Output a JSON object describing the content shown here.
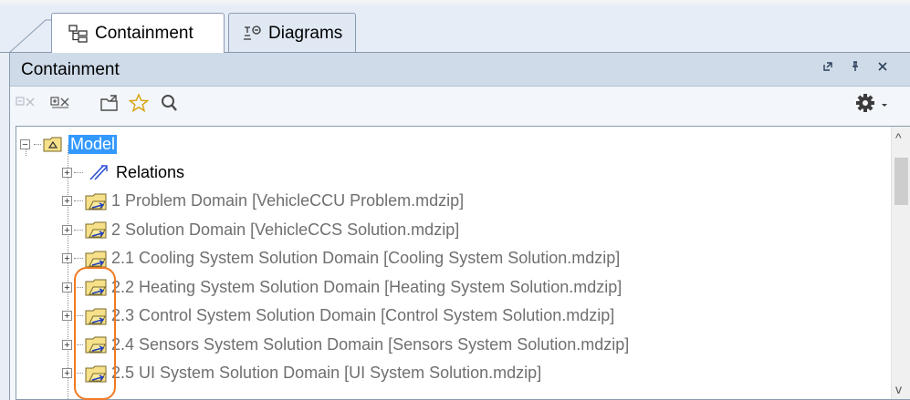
{
  "tabs": [
    {
      "label": "Containment",
      "icon": "containment-tree-icon"
    },
    {
      "label": "Diagrams",
      "icon": "diagrams-icon"
    }
  ],
  "panel": {
    "title": "Containment",
    "controls": [
      "restore-icon",
      "pin-icon",
      "close-icon"
    ]
  },
  "toolbar": {
    "icons": [
      "collapse-all-icon",
      "expand-all-icon",
      "open-project-icon",
      "favorite-star-icon",
      "search-icon",
      "settings-gear-icon",
      "dropdown-arrow-icon"
    ]
  },
  "tree": {
    "root": {
      "label": "Model"
    },
    "items": [
      {
        "label": "Relations",
        "icon": "relations-icon",
        "muted": false
      },
      {
        "label": "1 Problem Domain [VehicleCCU Problem.mdzip]",
        "icon": "shared-package-icon",
        "muted": true
      },
      {
        "label": "2 Solution Domain [VehicleCCS Solution.mdzip]",
        "icon": "shared-package-icon",
        "muted": true
      },
      {
        "label": "2.1 Cooling System Solution Domain [Cooling System Solution.mdzip]",
        "icon": "shared-package-icon",
        "muted": true
      },
      {
        "label": "2.2 Heating System Solution Domain [Heating System Solution.mdzip]",
        "icon": "shared-package-icon",
        "muted": true
      },
      {
        "label": "2.3 Control System Solution Domain [Control System Solution.mdzip]",
        "icon": "shared-package-icon",
        "muted": true
      },
      {
        "label": "2.4 Sensors System Solution Domain [Sensors System Solution.mdzip]",
        "icon": "shared-package-icon",
        "muted": true
      },
      {
        "label": "2.5 UI System Solution Domain [UI System Solution.mdzip]",
        "icon": "shared-package-icon",
        "muted": true
      }
    ]
  },
  "colors": {
    "selection": "#3399ff",
    "highlight_outline": "#f07a23",
    "folder_fill": "#f6e08a",
    "link_blue": "#2d4fd6"
  }
}
